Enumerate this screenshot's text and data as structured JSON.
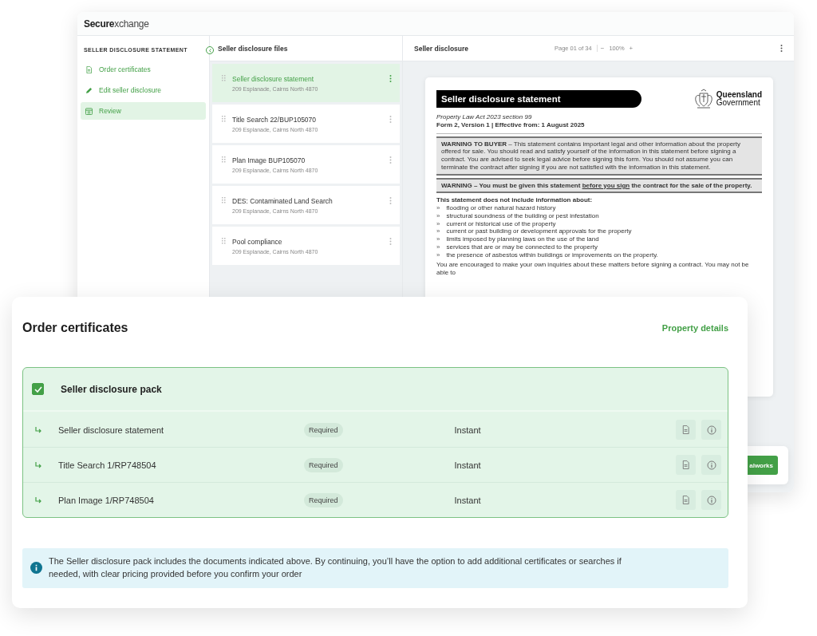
{
  "app": {
    "logo_primary": "Secure",
    "logo_secondary": "xchange"
  },
  "sidebar": {
    "heading": "SELLER DISCLOSURE STATEMENT",
    "items": [
      {
        "label": "Order certificates",
        "selected": false
      },
      {
        "label": "Edit seller disclosure",
        "selected": false
      },
      {
        "label": "Review",
        "selected": true
      }
    ]
  },
  "files_panel": {
    "title": "Seller disclosure files",
    "items": [
      {
        "title": "Seller disclosure statement",
        "address": "209 Esplanade, Cairns North 4870",
        "selected": true
      },
      {
        "title": "Title Search 22/BUP105070",
        "address": "209 Esplanade, Cairns North 4870",
        "selected": false
      },
      {
        "title": "Plan Image BUP105070",
        "address": "209 Esplanade, Cairns North 4870",
        "selected": false
      },
      {
        "title": "DES: Contaminated Land Search",
        "address": "209 Esplanade, Cairns North 4870",
        "selected": false
      },
      {
        "title": "Pool compliance",
        "address": "209 Esplanade, Cairns North 4870",
        "selected": false
      }
    ]
  },
  "viewer": {
    "title": "Seller disclosure",
    "page": "Page 01 of 34",
    "zoom_out": "−",
    "zoom": "100%",
    "zoom_in": "+",
    "document": {
      "title": "Seller disclosure statement",
      "issuer_line_1": "Queensland",
      "issuer_line_2": "Government",
      "act": "Property Law Act 2023 section 99",
      "form": "Form 2, Version 1 | Effective from: 1 August 2025",
      "warning_buyer": "**WARNING TO BUYER** – This statement contains important legal and other information about the property offered for sale. You should read and satisfy yourself of the information in this statement before signing a contract. You are advised to seek legal advice before signing this form. You should not assume you can terminate the contract after signing if you are not satisfied with the information in this statement.",
      "warning_sign": {
        "before": "WARNING – You must be given this statement ",
        "underlined": "before you sign",
        "after": " the contract for the sale of the property."
      },
      "list_heading": "This statement does not include information about:",
      "list": [
        {
          "marker": "»",
          "text": "flooding or other natural hazard history"
        },
        {
          "marker": "»",
          "text": "structural soundness of the building or pest infestation"
        },
        {
          "marker": "»",
          "text": "current or historical use of the property"
        },
        {
          "marker": "»",
          "text": "current or past building or development approvals for the property"
        },
        {
          "marker": "»",
          "text": "limits imposed by planning laws on the use of the land"
        },
        {
          "marker": "»",
          "text": "services that are or may be connected to the property"
        },
        {
          "marker": "»",
          "text": "the presence of asbestos within buildings or improvements on the property."
        }
      ],
      "closing": "You are encouraged to make your own inquiries about these matters before signing a contract. You may not be able to"
    }
  },
  "floating_button": "alworks",
  "order": {
    "title": "Order certificates",
    "link": "Property details",
    "pack": {
      "name": "Seller disclosure pack",
      "checked": true,
      "items": [
        {
          "name": "Seller disclosure statement",
          "badge": "Required",
          "delivery": "Instant"
        },
        {
          "name": "Title Search 1/RP748504",
          "badge": "Required",
          "delivery": "Instant"
        },
        {
          "name": "Plan Image 1/RP748504",
          "badge": "Required",
          "delivery": "Instant"
        }
      ]
    },
    "notice": "The Seller disclosure pack includes the documents indicated above. By continuing, you’ll have the option to add additional certificates or searches if needed, with clear pricing provided before you confirm your order"
  }
}
